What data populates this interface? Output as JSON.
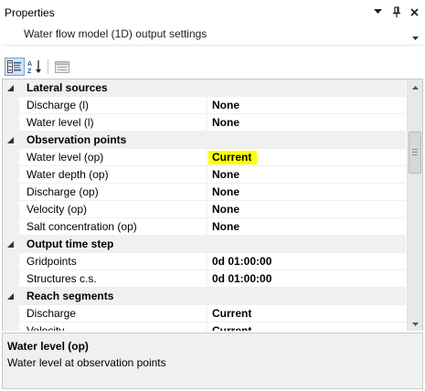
{
  "panel": {
    "title": "Properties",
    "object_selector": "Water flow model (1D) output settings"
  },
  "toolbar": {
    "categorized_icon": "categorized-view-icon",
    "alphabetical_icon": "alphabetical-sort-icon",
    "property_pages_icon": "property-pages-icon"
  },
  "grid": {
    "categories": [
      {
        "label": "Lateral sources",
        "properties": [
          {
            "name": "Discharge (l)",
            "value": "None"
          },
          {
            "name": "Water level (l)",
            "value": "None"
          }
        ]
      },
      {
        "label": "Observation points",
        "properties": [
          {
            "name": "Water level (op)",
            "value": "Current"
          },
          {
            "name": "Water depth (op)",
            "value": "None"
          },
          {
            "name": "Discharge (op)",
            "value": "None"
          },
          {
            "name": "Velocity (op)",
            "value": "None"
          },
          {
            "name": "Salt concentration (op)",
            "value": "None"
          }
        ]
      },
      {
        "label": "Output time step",
        "properties": [
          {
            "name": "Gridpoints",
            "value": "0d 01:00:00"
          },
          {
            "name": "Structures c.s.",
            "value": "0d 01:00:00"
          }
        ]
      },
      {
        "label": "Reach segments",
        "properties": [
          {
            "name": "Discharge",
            "value": "Current"
          },
          {
            "name": "Velocity",
            "value": "Current"
          }
        ]
      }
    ]
  },
  "help": {
    "title": "Water level (op)",
    "description": "Water level at observation points"
  },
  "colors": {
    "highlight": "#ffff00",
    "category_bg": "#f0f0f0",
    "active_tool": "#cfe3f6"
  }
}
